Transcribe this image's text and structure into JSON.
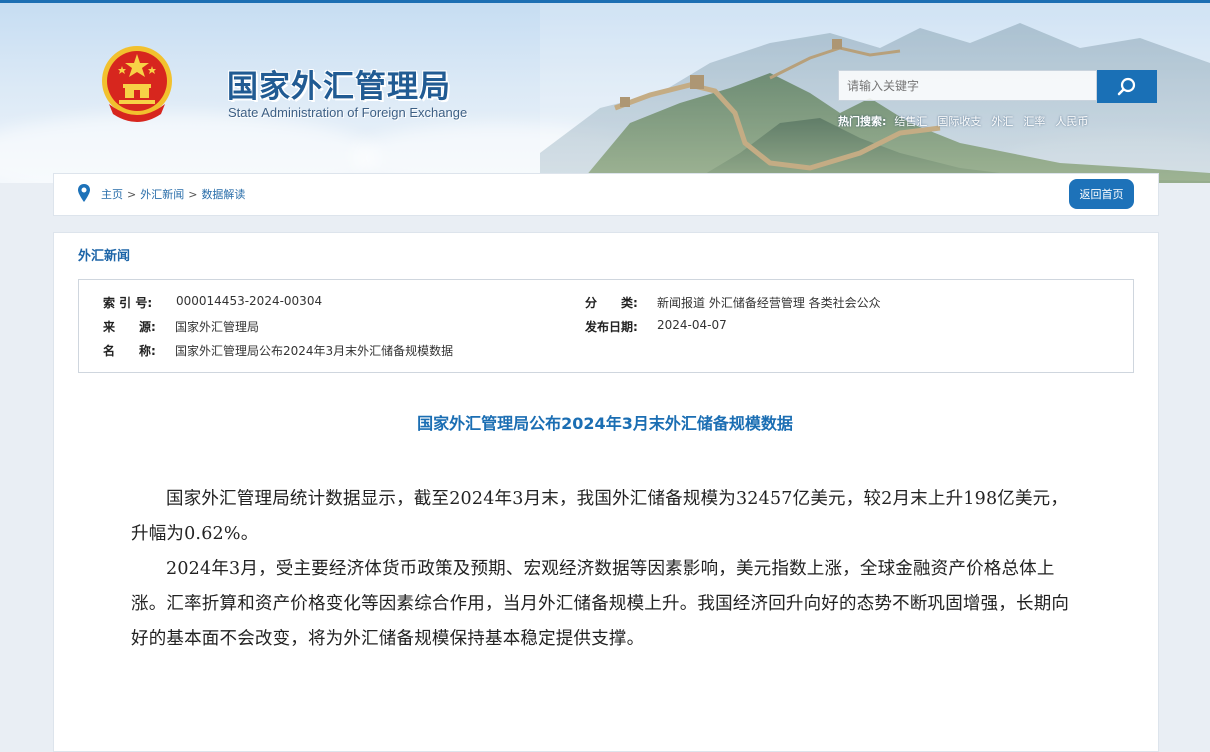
{
  "header": {
    "site_title": "国家外汇管理局",
    "site_subtitle": "State Administration of Foreign Exchange",
    "search_placeholder": "请输入关键字",
    "hot_label": "热门搜索:",
    "hot_items": [
      "结售汇",
      "国际收支",
      "外汇",
      "汇率",
      "人民币"
    ]
  },
  "breadcrumb": {
    "items": [
      "主页",
      "外汇新闻",
      "数据解读"
    ],
    "separator": ">",
    "back_button": "返回首页"
  },
  "section": {
    "title": "外汇新闻"
  },
  "meta": {
    "index_key": "索 引 号:",
    "index_value": "000014453-2024-00304",
    "category_key": "分　　类:",
    "category_value": "新闻报道  外汇储备经营管理  各类社会公众",
    "source_key": "来　　源:",
    "source_value": "国家外汇管理局",
    "date_key": "发布日期:",
    "date_value": "2024-04-07",
    "name_key": "名　　称:",
    "name_value": "国家外汇管理局公布2024年3月末外汇储备规模数据"
  },
  "article": {
    "title": "国家外汇管理局公布2024年3月末外汇储备规模数据",
    "paragraphs": [
      "国家外汇管理局统计数据显示，截至2024年3月末，我国外汇储备规模为32457亿美元，较2月末上升198亿美元，升幅为0.62%。",
      "2024年3月，受主要经济体货币政策及预期、宏观经济数据等因素影响，美元指数上涨，全球金融资产价格总体上涨。汇率折算和资产价格变化等因素综合作用，当月外汇储备规模上升。我国经济回升向好的态势不断巩固增强，长期向好的基本面不会改变，将为外汇储备规模保持基本稳定提供支撑。"
    ]
  },
  "colors": {
    "brand_blue": "#1a70b6",
    "title_blue": "#1b6eb3",
    "emblem_red": "#d7261e",
    "emblem_gold": "#f2c12e"
  }
}
